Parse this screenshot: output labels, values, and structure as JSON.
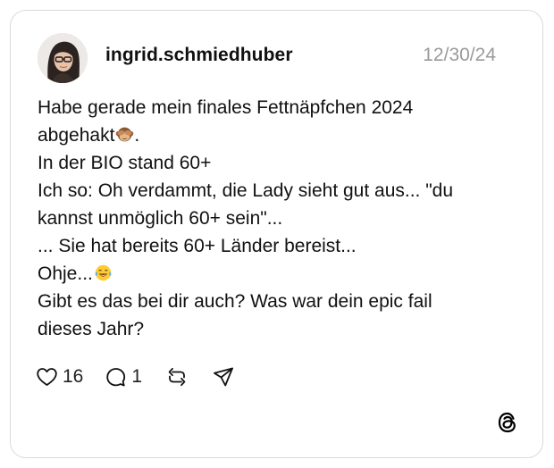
{
  "post": {
    "username": "ingrid.schmiedhuber",
    "date": "12/30/24",
    "lines": [
      {
        "text": "Habe gerade mein finales Fettnäpfchen 2024",
        "emoji": ""
      },
      {
        "text": "abgehakt",
        "emoji": "see-no-evil-monkey"
      },
      {
        "text": "In der BIO stand 60+",
        "emoji": ""
      },
      {
        "text": "Ich so: Oh verdammt, die Lady sieht gut aus... \"du",
        "emoji": ""
      },
      {
        "text": "kannst unmöglich 60+ sein\"...",
        "emoji": ""
      },
      {
        "text": "... Sie hat bereits 60+ Länder bereist...",
        "emoji": ""
      },
      {
        "text": "Ohje...",
        "emoji": "face-with-tears-of-joy"
      },
      {
        "text": "Gibt es das bei dir auch? Was war dein epic fail",
        "emoji": ""
      },
      {
        "text": "dieses Jahr?",
        "emoji": ""
      }
    ],
    "line2_suffix": "."
  },
  "actions": {
    "likes": "16",
    "comments": "1",
    "icons": [
      "heart-icon",
      "comment-icon",
      "repost-icon",
      "share-icon"
    ]
  },
  "branding": {
    "logo": "threads-logo-icon"
  },
  "colors": {
    "text": "#111111",
    "muted": "#9a9a9a",
    "border": "#d9d9d9"
  }
}
